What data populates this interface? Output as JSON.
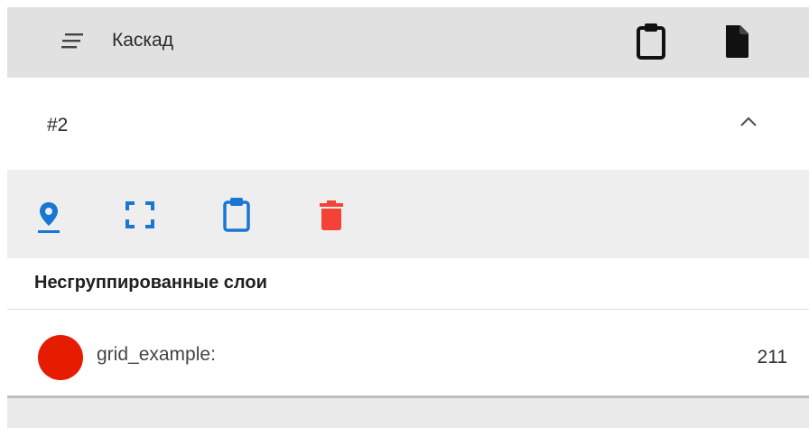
{
  "topbar": {
    "title": "Каскад",
    "menu_icon": "menu-lines-icon",
    "clipboard_icon": "clipboard-icon",
    "file_icon": "file-icon"
  },
  "group": {
    "title": "#2",
    "toggle_icon": "chevron-up-icon"
  },
  "toolbar": {
    "icons": [
      "location-pin-icon",
      "fit-extent-icon",
      "clipboard-icon",
      "delete-icon"
    ],
    "accent_color": "#1976d2",
    "delete_color": "#f44336"
  },
  "section": {
    "title": "Несгруппированные слои"
  },
  "layers": [
    {
      "name": "grid_example:",
      "count": "211",
      "color": "#e51c00"
    }
  ]
}
